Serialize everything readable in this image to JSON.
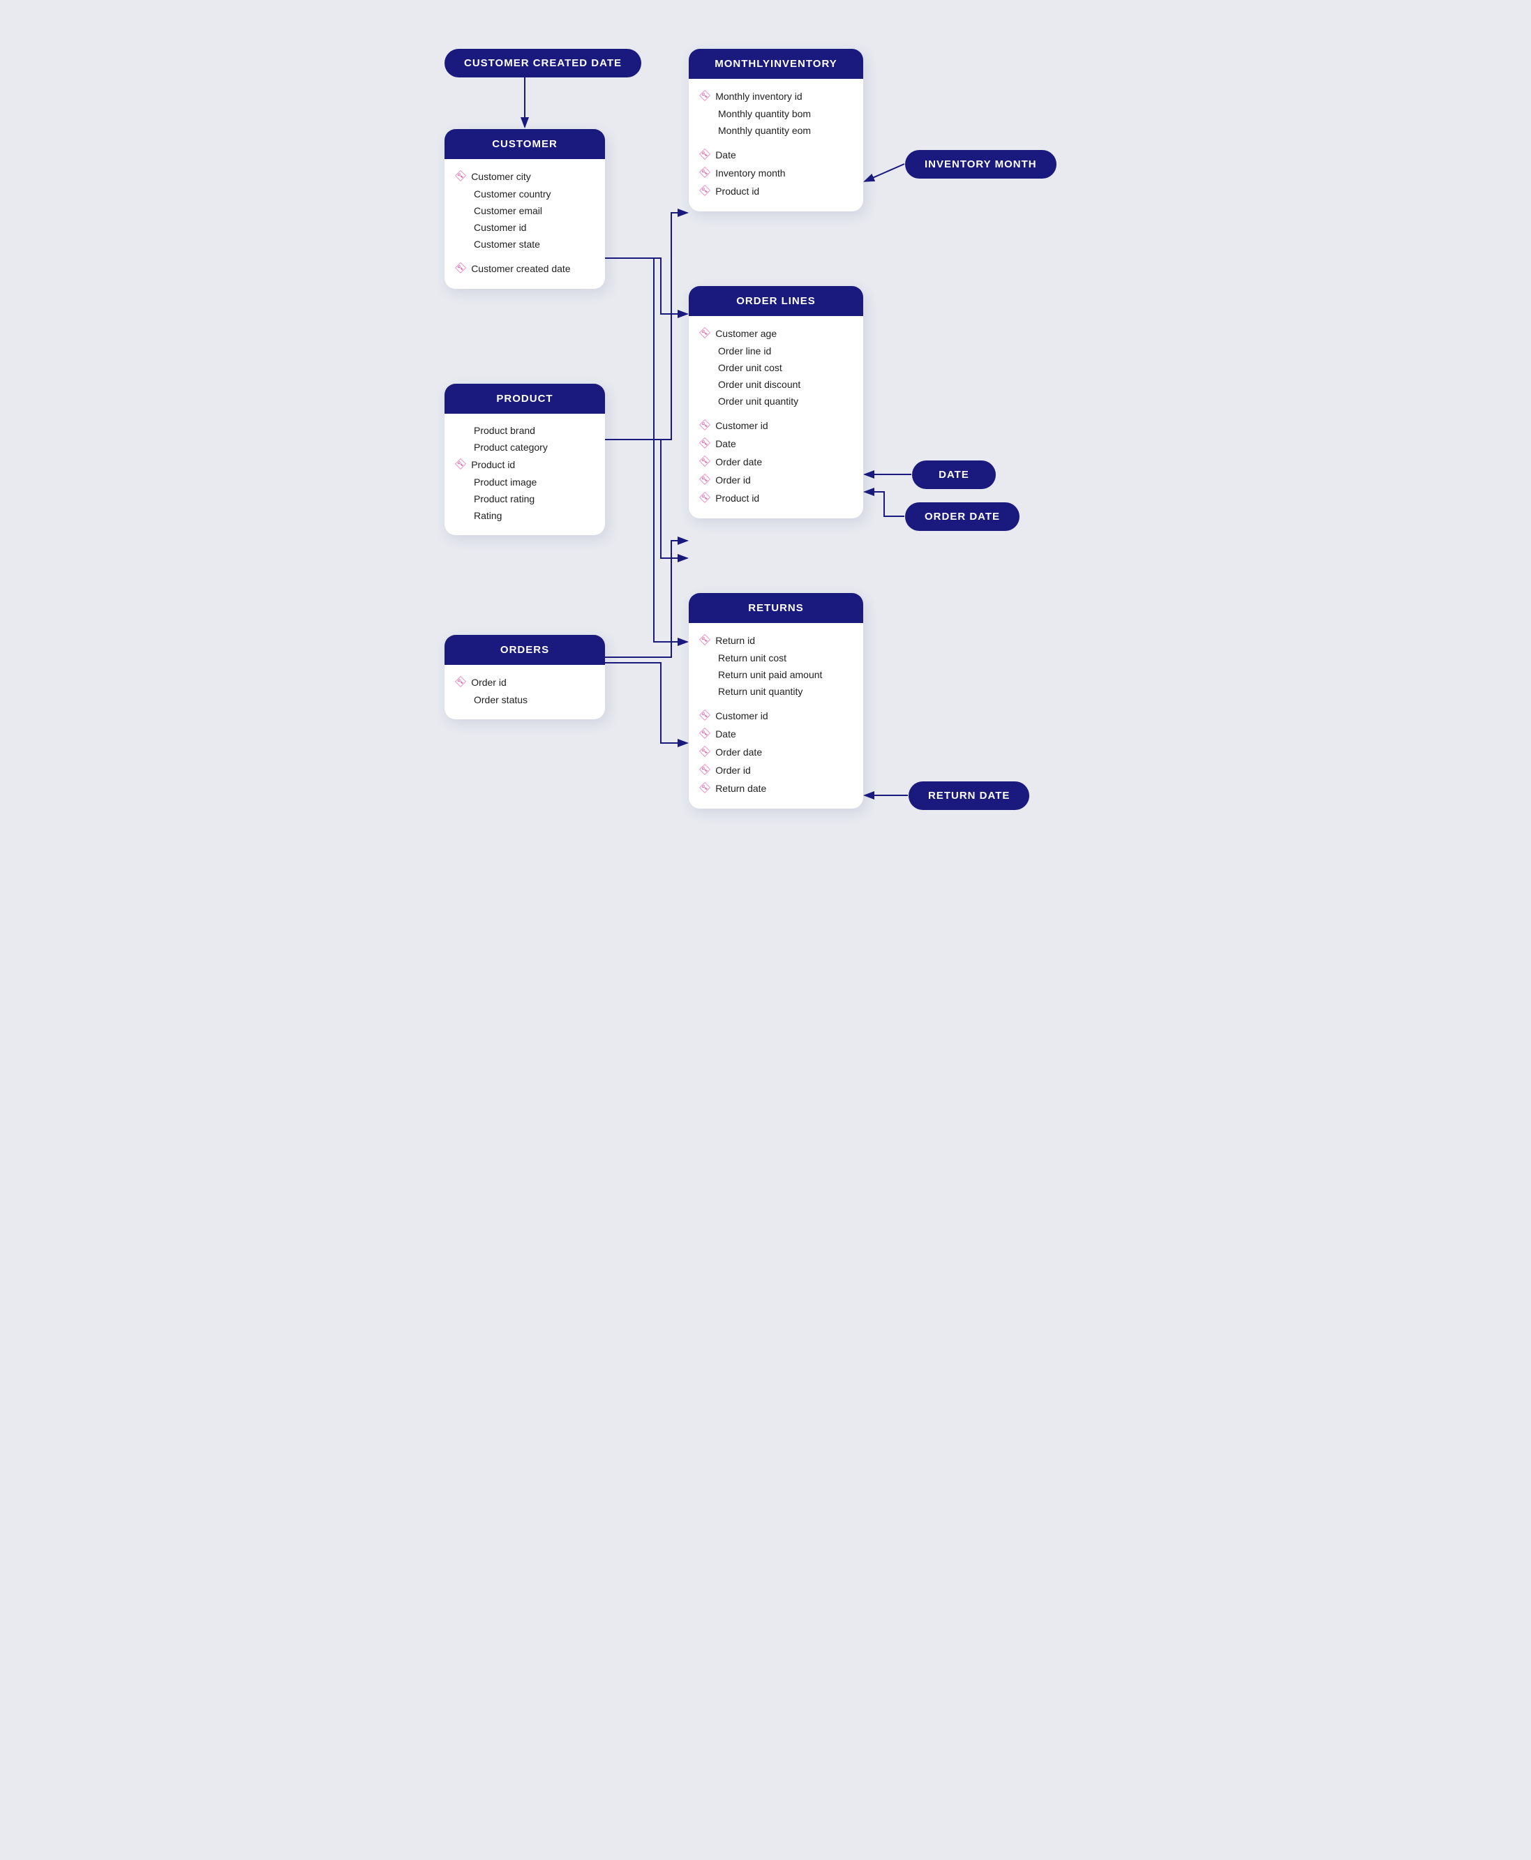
{
  "pills": {
    "customerCreatedDate": "CUSTOMER CREATED DATE",
    "inventoryMonth": "INVENTORY MONTH",
    "date": "DATE",
    "orderDate": "ORDER DATE",
    "returnDate": "RETURN DATE"
  },
  "tables": {
    "customer": {
      "title": "CUSTOMER",
      "fields": [
        {
          "label": "Customer city",
          "key": true
        },
        {
          "label": "Customer country",
          "key": false
        },
        {
          "label": "Customer email",
          "key": false
        },
        {
          "label": "Customer id",
          "key": false
        },
        {
          "label": "Customer state",
          "key": false
        },
        {
          "label": "Customer created date",
          "key": true,
          "spacerBefore": true
        }
      ]
    },
    "monthlyInventory": {
      "title": "MONTHLYINVENTORY",
      "fields": [
        {
          "label": "Monthly inventory id",
          "key": true
        },
        {
          "label": "Monthly quantity bom",
          "key": false
        },
        {
          "label": "Monthly quantity eom",
          "key": false
        },
        {
          "label": "Date",
          "key": true,
          "spacerBefore": true
        },
        {
          "label": "Inventory month",
          "key": true
        },
        {
          "label": "Product id",
          "key": true
        }
      ]
    },
    "orderLines": {
      "title": "ORDER LINES",
      "fields": [
        {
          "label": "Customer age",
          "key": true
        },
        {
          "label": "Order line id",
          "key": false
        },
        {
          "label": "Order unit cost",
          "key": false
        },
        {
          "label": "Order unit discount",
          "key": false
        },
        {
          "label": "Order unit quantity",
          "key": false
        },
        {
          "label": "Customer id",
          "key": true,
          "spacerBefore": true
        },
        {
          "label": "Date",
          "key": true
        },
        {
          "label": "Order date",
          "key": true
        },
        {
          "label": "Order id",
          "key": true
        },
        {
          "label": "Product id",
          "key": true
        }
      ]
    },
    "product": {
      "title": "PRODUCT",
      "fields": [
        {
          "label": "Product brand",
          "key": false
        },
        {
          "label": "Product category",
          "key": false
        },
        {
          "label": "Product id",
          "key": true
        },
        {
          "label": "Product image",
          "key": false
        },
        {
          "label": "Product rating",
          "key": false
        },
        {
          "label": "Rating",
          "key": false
        }
      ]
    },
    "orders": {
      "title": "ORDERS",
      "fields": [
        {
          "label": "Order id",
          "key": true
        },
        {
          "label": "Order status",
          "key": false
        }
      ]
    },
    "returns": {
      "title": "RETURNS",
      "fields": [
        {
          "label": "Return id",
          "key": true
        },
        {
          "label": "Return unit cost",
          "key": false
        },
        {
          "label": "Return unit paid amount",
          "key": false
        },
        {
          "label": "Return unit quantity",
          "key": false
        },
        {
          "label": "Customer id",
          "key": true,
          "spacerBefore": true
        },
        {
          "label": "Date",
          "key": true
        },
        {
          "label": "Order date",
          "key": true
        },
        {
          "label": "Order id",
          "key": true
        },
        {
          "label": "Return date",
          "key": true
        }
      ]
    }
  }
}
